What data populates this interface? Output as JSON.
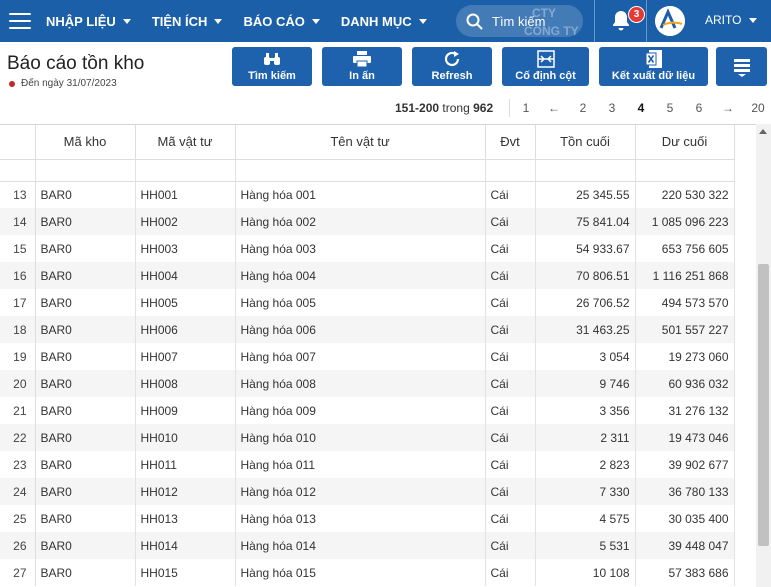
{
  "nav": {
    "items": [
      {
        "label": "NHẬP LIỆU"
      },
      {
        "label": "TIỆN ÍCH"
      },
      {
        "label": "BÁO CÁO"
      },
      {
        "label": "DANH MỤC"
      }
    ],
    "search_placeholder": "Tìm kiếm",
    "search_watermark": [
      "CTY",
      "CÔNG TY"
    ],
    "notification_count": "3",
    "username": "ARITO"
  },
  "header": {
    "title": "Báo cáo tồn kho",
    "subtitle": "Đến ngày 31/07/2023"
  },
  "toolbar": {
    "search_label": "Tìm kiếm",
    "print_label": "In ấn",
    "refresh_label": "Refresh",
    "freeze_label": "Cố định cột",
    "export_label": "Kết xuất dữ liệu"
  },
  "pager": {
    "range": "151-200",
    "of_label": "trong",
    "total": "962",
    "pages": [
      "1",
      "←",
      "2",
      "3",
      "4",
      "5",
      "6",
      "→",
      "20"
    ],
    "active": "4"
  },
  "table": {
    "columns": [
      "Mã kho",
      "Mã vật tư",
      "Tên vật tư",
      "Đvt",
      "Tồn cuối",
      "Dư cuối"
    ],
    "rows": [
      {
        "idx": "13",
        "kho": "BAR0",
        "ma": "HH001",
        "ten": "Hàng hóa 001",
        "dvt": "Cái",
        "ton": "25 345.55",
        "du": "220 530 322"
      },
      {
        "idx": "14",
        "kho": "BAR0",
        "ma": "HH002",
        "ten": "Hàng hóa 002",
        "dvt": "Cái",
        "ton": "75 841.04",
        "du": "1 085 096 223"
      },
      {
        "idx": "15",
        "kho": "BAR0",
        "ma": "HH003",
        "ten": "Hàng hóa 003",
        "dvt": "Cái",
        "ton": "54 933.67",
        "du": "653 756 605"
      },
      {
        "idx": "16",
        "kho": "BAR0",
        "ma": "HH004",
        "ten": "Hàng hóa 004",
        "dvt": "Cái",
        "ton": "70 806.51",
        "du": "1 116 251 868"
      },
      {
        "idx": "17",
        "kho": "BAR0",
        "ma": "HH005",
        "ten": "Hàng hóa 005",
        "dvt": "Cái",
        "ton": "26 706.52",
        "du": "494 573 570"
      },
      {
        "idx": "18",
        "kho": "BAR0",
        "ma": "HH006",
        "ten": "Hàng hóa 006",
        "dvt": "Cái",
        "ton": "31 463.25",
        "du": "501 557 227"
      },
      {
        "idx": "19",
        "kho": "BAR0",
        "ma": "HH007",
        "ten": "Hàng hóa 007",
        "dvt": "Cái",
        "ton": "3 054",
        "du": "19 273 060"
      },
      {
        "idx": "20",
        "kho": "BAR0",
        "ma": "HH008",
        "ten": "Hàng hóa 008",
        "dvt": "Cái",
        "ton": "9 746",
        "du": "60 936 032"
      },
      {
        "idx": "21",
        "kho": "BAR0",
        "ma": "HH009",
        "ten": "Hàng hóa 009",
        "dvt": "Cái",
        "ton": "3 356",
        "du": "31 276 132"
      },
      {
        "idx": "22",
        "kho": "BAR0",
        "ma": "HH010",
        "ten": "Hàng hóa 010",
        "dvt": "Cái",
        "ton": "2 311",
        "du": "19 473 046"
      },
      {
        "idx": "23",
        "kho": "BAR0",
        "ma": "HH011",
        "ten": "Hàng hóa 011",
        "dvt": "Cái",
        "ton": "2 823",
        "du": "39 902 677"
      },
      {
        "idx": "24",
        "kho": "BAR0",
        "ma": "HH012",
        "ten": "Hàng hóa 012",
        "dvt": "Cái",
        "ton": "7 330",
        "du": "36 780 133"
      },
      {
        "idx": "25",
        "kho": "BAR0",
        "ma": "HH013",
        "ten": "Hàng hóa 013",
        "dvt": "Cái",
        "ton": "4 575",
        "du": "30 035 400"
      },
      {
        "idx": "26",
        "kho": "BAR0",
        "ma": "HH014",
        "ten": "Hàng hóa 014",
        "dvt": "Cái",
        "ton": "5 531",
        "du": "39 448 047"
      },
      {
        "idx": "27",
        "kho": "BAR0",
        "ma": "HH015",
        "ten": "Hàng hóa 015",
        "dvt": "Cái",
        "ton": "10 108",
        "du": "57 383 686"
      }
    ]
  },
  "colors": {
    "nav_bg": "#1a5fa8",
    "button_bg": "#1e62ad",
    "badge": "#e53935",
    "status_dot": "#c62828"
  }
}
